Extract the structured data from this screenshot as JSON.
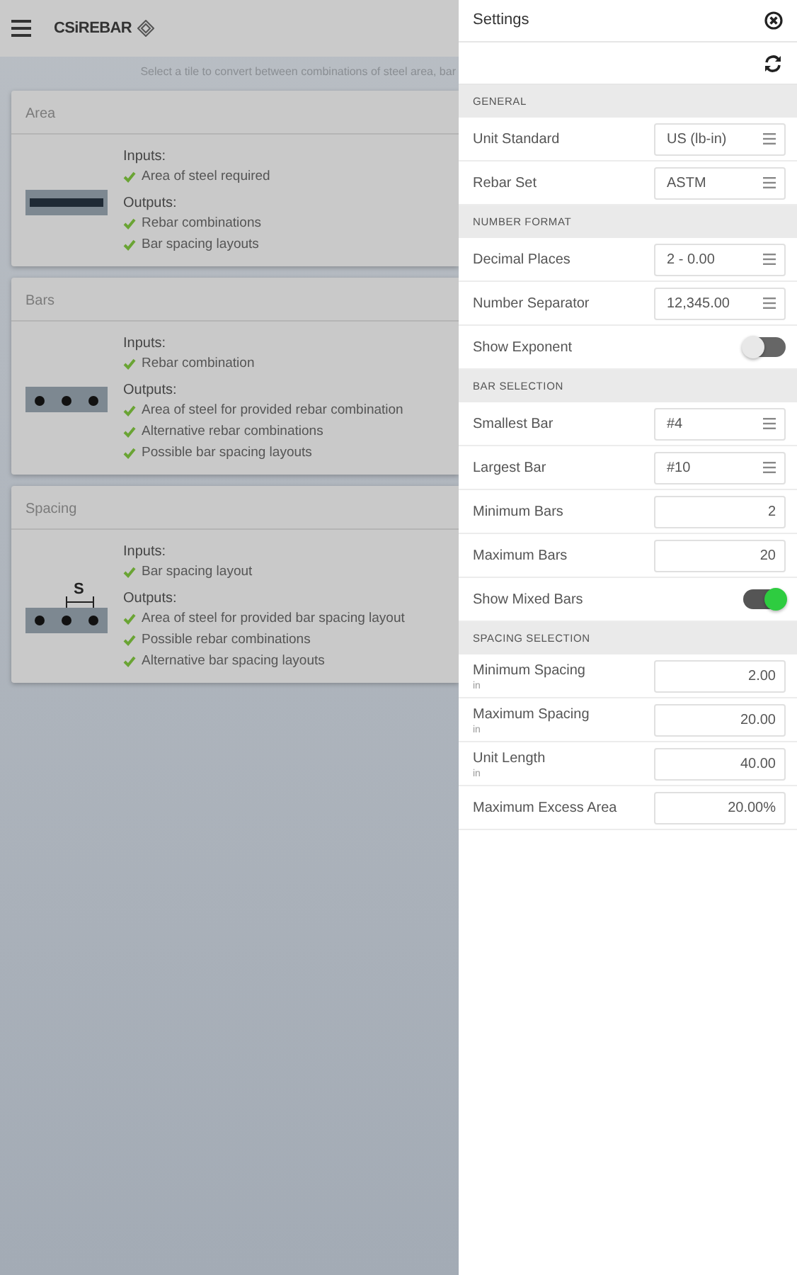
{
  "app_bar": {
    "logo": "CSiREBAR"
  },
  "intro": "Select a tile to convert between combinations of steel area, bar",
  "tiles": [
    {
      "title": "Area",
      "kind": "area",
      "inputs_label": "Inputs:",
      "inputs": [
        "Area of steel required"
      ],
      "outputs_label": "Outputs:",
      "outputs": [
        "Rebar combinations",
        "Bar spacing layouts"
      ]
    },
    {
      "title": "Bars",
      "kind": "bars",
      "inputs_label": "Inputs:",
      "inputs": [
        "Rebar combination"
      ],
      "outputs_label": "Outputs:",
      "outputs": [
        "Area of steel for provided rebar combination",
        "Alternative rebar combinations",
        "Possible bar spacing layouts"
      ]
    },
    {
      "title": "Spacing",
      "kind": "spacing",
      "symbol": "S",
      "inputs_label": "Inputs:",
      "inputs": [
        "Bar spacing layout"
      ],
      "outputs_label": "Outputs:",
      "outputs": [
        "Area of steel for provided bar spacing layout",
        "Possible rebar combinations",
        "Alternative bar spacing layouts"
      ]
    }
  ],
  "settings": {
    "title": "Settings",
    "sections": [
      {
        "heading": "GENERAL",
        "rows": [
          {
            "kind": "select",
            "label": "Unit Standard",
            "value": "US (lb-in)"
          },
          {
            "kind": "select",
            "label": "Rebar Set",
            "value": "ASTM"
          }
        ]
      },
      {
        "heading": "NUMBER FORMAT",
        "rows": [
          {
            "kind": "select",
            "label": "Decimal Places",
            "value": "2 - 0.00"
          },
          {
            "kind": "select",
            "label": "Number Separator",
            "value": "12,345.00"
          },
          {
            "kind": "toggle",
            "label": "Show Exponent",
            "on": false
          }
        ]
      },
      {
        "heading": "BAR SELECTION",
        "rows": [
          {
            "kind": "select",
            "label": "Smallest Bar",
            "value": "#4"
          },
          {
            "kind": "select",
            "label": "Largest Bar",
            "value": "#10"
          },
          {
            "kind": "number",
            "label": "Minimum Bars",
            "value": "2"
          },
          {
            "kind": "number",
            "label": "Maximum Bars",
            "value": "20"
          },
          {
            "kind": "toggle",
            "label": "Show Mixed Bars",
            "on": true
          }
        ]
      },
      {
        "heading": "SPACING SELECTION",
        "rows": [
          {
            "kind": "number",
            "label": "Minimum Spacing",
            "unit": "in",
            "value": "2.00"
          },
          {
            "kind": "number",
            "label": "Maximum Spacing",
            "unit": "in",
            "value": "20.00"
          },
          {
            "kind": "number",
            "label": "Unit Length",
            "unit": "in",
            "value": "40.00"
          },
          {
            "kind": "number",
            "label": "Maximum Excess Area",
            "value": "20.00%"
          }
        ]
      }
    ]
  }
}
